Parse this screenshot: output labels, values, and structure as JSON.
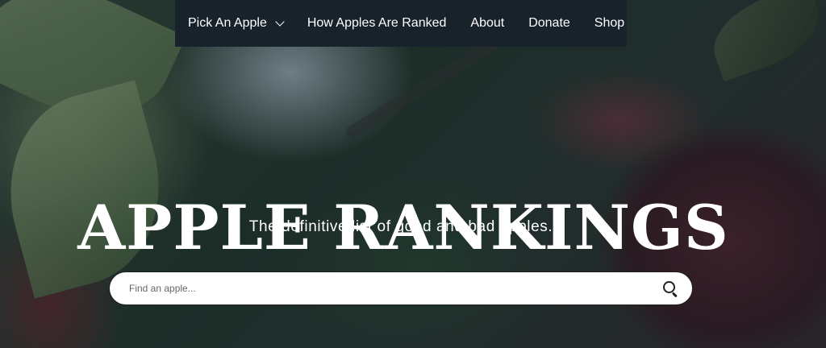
{
  "nav": {
    "items": [
      {
        "label": "Pick An Apple",
        "has_dropdown": true
      },
      {
        "label": "How Apples Are Ranked",
        "has_dropdown": false
      },
      {
        "label": "About",
        "has_dropdown": false
      },
      {
        "label": "Donate",
        "has_dropdown": false
      },
      {
        "label": "Shop",
        "has_dropdown": false
      }
    ]
  },
  "hero": {
    "title": "APPLE RANKINGS",
    "subtitle": "The definitive list of good and bad apples."
  },
  "search": {
    "placeholder": "Find an apple...",
    "value": "",
    "icon": "search-icon"
  },
  "colors": {
    "nav_background": "#18222b",
    "text": "#ffffff",
    "search_background": "#ffffff"
  }
}
